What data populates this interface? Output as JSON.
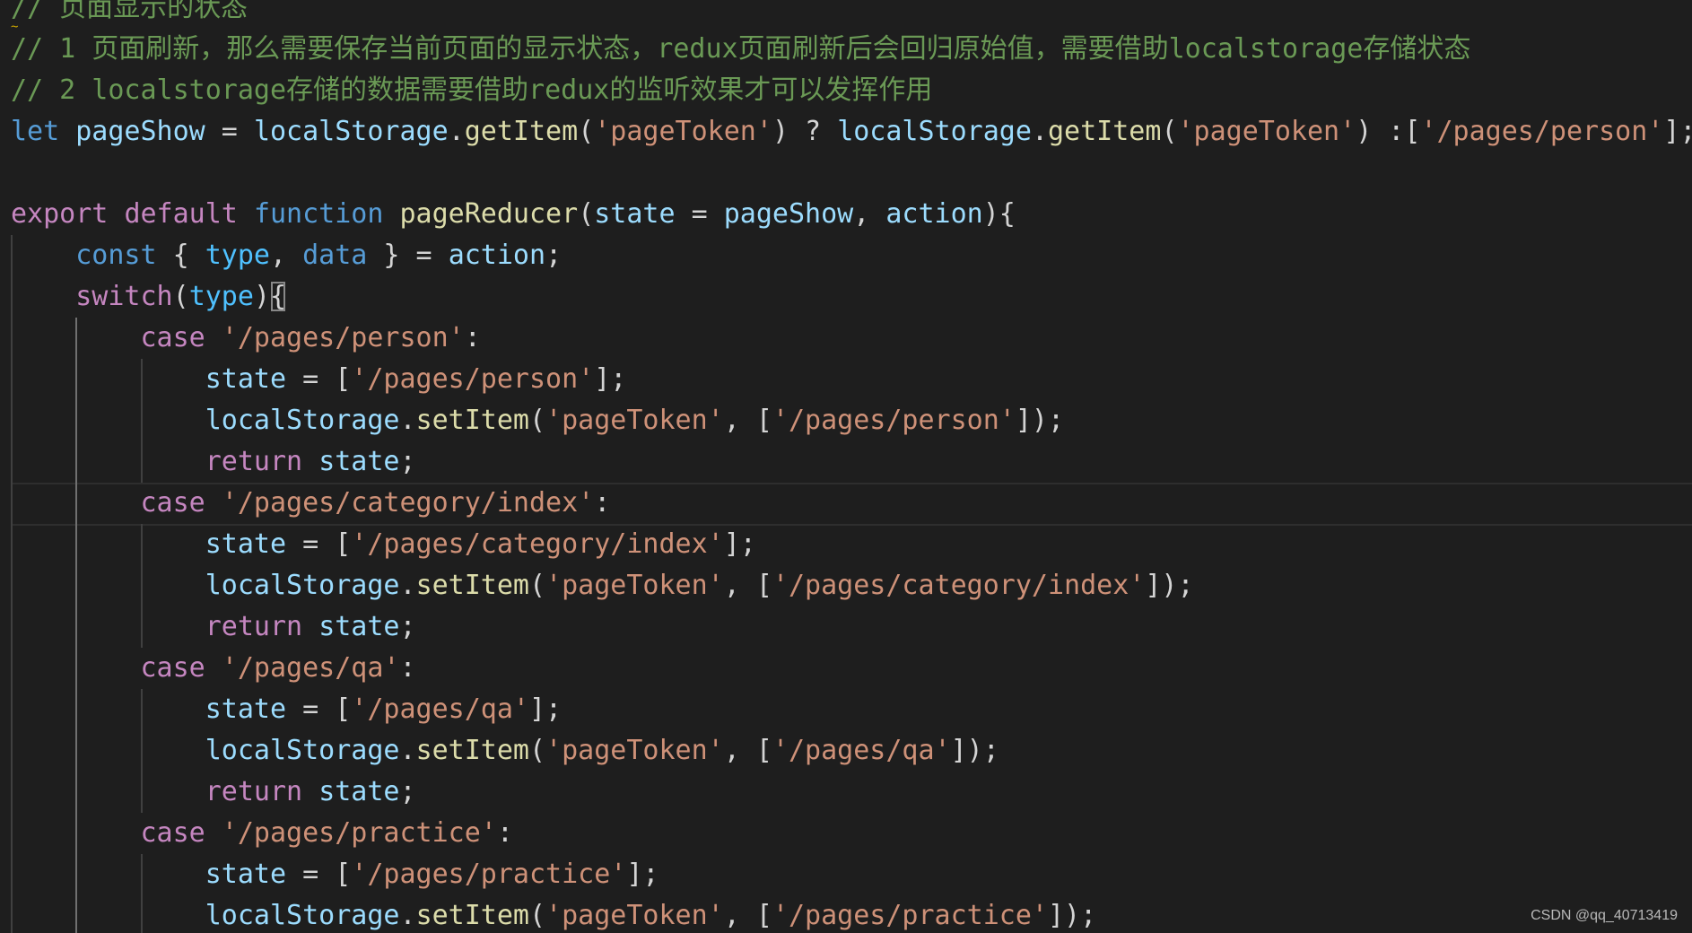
{
  "editor": {
    "language": "javascript",
    "theme": "dark",
    "lines": [
      [
        {
          "t": "// 页面显示的状态",
          "c": "comment"
        }
      ],
      [
        {
          "t": "// 1 页面刷新，那么需要保存当前页面的显示状态，redux页面刷新后会回归原始值，需要借助localstorage存储状态",
          "c": "comment"
        }
      ],
      [
        {
          "t": "// 2 localstorage存储的数据需要借助redux的监听效果才可以发挥作用",
          "c": "comment"
        }
      ],
      [
        {
          "t": "let",
          "c": "kw-blue"
        },
        {
          "t": " ",
          "c": "punc"
        },
        {
          "t": "pageShow",
          "c": "var"
        },
        {
          "t": " = ",
          "c": "punc"
        },
        {
          "t": "localStorage",
          "c": "var"
        },
        {
          "t": ".",
          "c": "punc"
        },
        {
          "t": "getItem",
          "c": "fn"
        },
        {
          "t": "(",
          "c": "punc"
        },
        {
          "t": "'pageToken'",
          "c": "str"
        },
        {
          "t": ") ? ",
          "c": "punc"
        },
        {
          "t": "localStorage",
          "c": "var"
        },
        {
          "t": ".",
          "c": "punc"
        },
        {
          "t": "getItem",
          "c": "fn"
        },
        {
          "t": "(",
          "c": "punc"
        },
        {
          "t": "'pageToken'",
          "c": "str"
        },
        {
          "t": ") :[",
          "c": "punc"
        },
        {
          "t": "'/pages/person'",
          "c": "str"
        },
        {
          "t": "];",
          "c": "punc"
        }
      ],
      [],
      [
        {
          "t": "export",
          "c": "kw-purple"
        },
        {
          "t": " ",
          "c": "punc"
        },
        {
          "t": "default",
          "c": "kw-purple"
        },
        {
          "t": " ",
          "c": "punc"
        },
        {
          "t": "function",
          "c": "kw-blue"
        },
        {
          "t": " ",
          "c": "punc"
        },
        {
          "t": "pageReducer",
          "c": "fn"
        },
        {
          "t": "(",
          "c": "punc"
        },
        {
          "t": "state",
          "c": "var"
        },
        {
          "t": " = ",
          "c": "punc"
        },
        {
          "t": "pageShow",
          "c": "var"
        },
        {
          "t": ", ",
          "c": "punc"
        },
        {
          "t": "action",
          "c": "var"
        },
        {
          "t": "){",
          "c": "punc"
        }
      ],
      [
        {
          "t": "    ",
          "c": "punc"
        },
        {
          "t": "const",
          "c": "kw-blue"
        },
        {
          "t": " { ",
          "c": "punc"
        },
        {
          "t": "type",
          "c": "const"
        },
        {
          "t": ", ",
          "c": "punc"
        },
        {
          "t": "data",
          "c": "kw-blue"
        },
        {
          "t": " } = ",
          "c": "punc"
        },
        {
          "t": "action",
          "c": "var"
        },
        {
          "t": ";",
          "c": "punc"
        }
      ],
      [
        {
          "t": "    ",
          "c": "punc"
        },
        {
          "t": "switch",
          "c": "kw-purple"
        },
        {
          "t": "(",
          "c": "punc"
        },
        {
          "t": "type",
          "c": "const"
        },
        {
          "t": ")",
          "c": "punc"
        },
        {
          "t": "{",
          "c": "bracket-match"
        }
      ],
      [
        {
          "t": "        ",
          "c": "punc"
        },
        {
          "t": "case",
          "c": "kw-purple"
        },
        {
          "t": " ",
          "c": "punc"
        },
        {
          "t": "'/pages/person'",
          "c": "str"
        },
        {
          "t": ":",
          "c": "punc"
        }
      ],
      [
        {
          "t": "            ",
          "c": "punc"
        },
        {
          "t": "state",
          "c": "var"
        },
        {
          "t": " = [",
          "c": "punc"
        },
        {
          "t": "'/pages/person'",
          "c": "str"
        },
        {
          "t": "];",
          "c": "punc"
        }
      ],
      [
        {
          "t": "            ",
          "c": "punc"
        },
        {
          "t": "localStorage",
          "c": "var"
        },
        {
          "t": ".",
          "c": "punc"
        },
        {
          "t": "setItem",
          "c": "fn"
        },
        {
          "t": "(",
          "c": "punc"
        },
        {
          "t": "'pageToken'",
          "c": "str"
        },
        {
          "t": ", [",
          "c": "punc"
        },
        {
          "t": "'/pages/person'",
          "c": "str"
        },
        {
          "t": "]);",
          "c": "punc"
        }
      ],
      [
        {
          "t": "            ",
          "c": "punc"
        },
        {
          "t": "return",
          "c": "kw-purple"
        },
        {
          "t": " ",
          "c": "punc"
        },
        {
          "t": "state",
          "c": "var"
        },
        {
          "t": ";",
          "c": "punc"
        }
      ],
      [
        {
          "t": "        ",
          "c": "punc"
        },
        {
          "t": "case",
          "c": "kw-purple"
        },
        {
          "t": " ",
          "c": "punc"
        },
        {
          "t": "'/pages/category/index'",
          "c": "str"
        },
        {
          "t": ":",
          "c": "punc"
        }
      ],
      [
        {
          "t": "            ",
          "c": "punc"
        },
        {
          "t": "state",
          "c": "var"
        },
        {
          "t": " = [",
          "c": "punc"
        },
        {
          "t": "'/pages/category/index'",
          "c": "str"
        },
        {
          "t": "];",
          "c": "punc"
        }
      ],
      [
        {
          "t": "            ",
          "c": "punc"
        },
        {
          "t": "localStorage",
          "c": "var"
        },
        {
          "t": ".",
          "c": "punc"
        },
        {
          "t": "setItem",
          "c": "fn"
        },
        {
          "t": "(",
          "c": "punc"
        },
        {
          "t": "'pageToken'",
          "c": "str"
        },
        {
          "t": ", [",
          "c": "punc"
        },
        {
          "t": "'/pages/category/index'",
          "c": "str"
        },
        {
          "t": "]);",
          "c": "punc"
        }
      ],
      [
        {
          "t": "            ",
          "c": "punc"
        },
        {
          "t": "return",
          "c": "kw-purple"
        },
        {
          "t": " ",
          "c": "punc"
        },
        {
          "t": "state",
          "c": "var"
        },
        {
          "t": ";",
          "c": "punc"
        }
      ],
      [
        {
          "t": "        ",
          "c": "punc"
        },
        {
          "t": "case",
          "c": "kw-purple"
        },
        {
          "t": " ",
          "c": "punc"
        },
        {
          "t": "'/pages/qa'",
          "c": "str"
        },
        {
          "t": ":",
          "c": "punc"
        }
      ],
      [
        {
          "t": "            ",
          "c": "punc"
        },
        {
          "t": "state",
          "c": "var"
        },
        {
          "t": " = [",
          "c": "punc"
        },
        {
          "t": "'/pages/qa'",
          "c": "str"
        },
        {
          "t": "];",
          "c": "punc"
        }
      ],
      [
        {
          "t": "            ",
          "c": "punc"
        },
        {
          "t": "localStorage",
          "c": "var"
        },
        {
          "t": ".",
          "c": "punc"
        },
        {
          "t": "setItem",
          "c": "fn"
        },
        {
          "t": "(",
          "c": "punc"
        },
        {
          "t": "'pageToken'",
          "c": "str"
        },
        {
          "t": ", [",
          "c": "punc"
        },
        {
          "t": "'/pages/qa'",
          "c": "str"
        },
        {
          "t": "]);",
          "c": "punc"
        }
      ],
      [
        {
          "t": "            ",
          "c": "punc"
        },
        {
          "t": "return",
          "c": "kw-purple"
        },
        {
          "t": " ",
          "c": "punc"
        },
        {
          "t": "state",
          "c": "var"
        },
        {
          "t": ";",
          "c": "punc"
        }
      ],
      [
        {
          "t": "        ",
          "c": "punc"
        },
        {
          "t": "case",
          "c": "kw-purple"
        },
        {
          "t": " ",
          "c": "punc"
        },
        {
          "t": "'/pages/practice'",
          "c": "str"
        },
        {
          "t": ":",
          "c": "punc"
        }
      ],
      [
        {
          "t": "            ",
          "c": "punc"
        },
        {
          "t": "state",
          "c": "var"
        },
        {
          "t": " = [",
          "c": "punc"
        },
        {
          "t": "'/pages/practice'",
          "c": "str"
        },
        {
          "t": "];",
          "c": "punc"
        }
      ],
      [
        {
          "t": "            ",
          "c": "punc"
        },
        {
          "t": "localStorage",
          "c": "var"
        },
        {
          "t": ".",
          "c": "punc"
        },
        {
          "t": "setItem",
          "c": "fn"
        },
        {
          "t": "(",
          "c": "punc"
        },
        {
          "t": "'pageToken'",
          "c": "str"
        },
        {
          "t": ", [",
          "c": "punc"
        },
        {
          "t": "'/pages/practice'",
          "c": "str"
        },
        {
          "t": "]);",
          "c": "punc"
        }
      ]
    ],
    "indent_levels": [
      0,
      0,
      0,
      0,
      0,
      0,
      1,
      1,
      2,
      3,
      3,
      3,
      2,
      3,
      3,
      3,
      2,
      3,
      3,
      3,
      2,
      3,
      3
    ],
    "current_line": 12
  },
  "colors": {
    "background": "#1e1e1e",
    "comment": "#6a9955",
    "keyword_blue": "#569cd6",
    "keyword_purple": "#c586c0",
    "variable": "#9cdcfe",
    "constant": "#4fc1ff",
    "function": "#dcdcaa",
    "string": "#ce9178",
    "punctuation": "#d4d4d4"
  },
  "watermark": {
    "text": "CSDN @qq_40713419"
  }
}
